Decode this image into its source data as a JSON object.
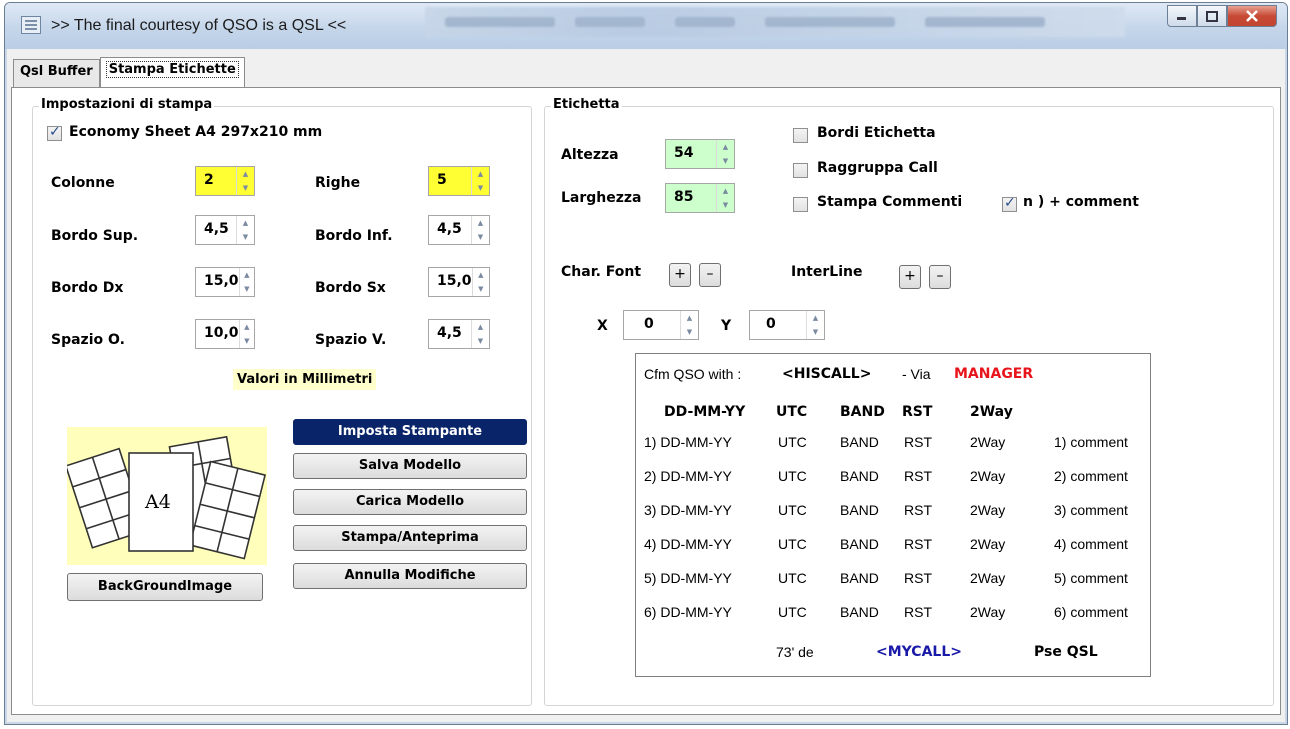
{
  "window": {
    "title": ">> The final courtesy of QSO is a QSL <<",
    "minimize": "minimize",
    "maximize": "maximize",
    "close": "close"
  },
  "tabs": [
    {
      "label": "Qsl Buffer",
      "active": false
    },
    {
      "label": "Stampa Etichette",
      "active": true
    }
  ],
  "print_settings": {
    "title": "Impostazioni di stampa",
    "economy_sheet": {
      "label": "Economy Sheet A4 297x210 mm",
      "checked": true
    },
    "colonne": {
      "label": "Colonne",
      "value": "2"
    },
    "righe": {
      "label": "Righe",
      "value": "5"
    },
    "bordo_sup": {
      "label": "Bordo Sup.",
      "value": "4,5"
    },
    "bordo_inf": {
      "label": "Bordo Inf.",
      "value": "4,5"
    },
    "bordo_dx": {
      "label": "Bordo Dx",
      "value": "15,0"
    },
    "bordo_sx": {
      "label": "Bordo Sx",
      "value": "15,0"
    },
    "spazio_o": {
      "label": "Spazio O.",
      "value": "10,0"
    },
    "spazio_v": {
      "label": "Spazio V.",
      "value": "4,5"
    },
    "units_note": "Valori in Millimetri",
    "a4_text": "A4",
    "buttons": {
      "imposta_stampante": "Imposta Stampante",
      "salva_modello": "Salva Modello",
      "carica_modello": "Carica Modello",
      "stampa_anteprima": "Stampa/Anteprima",
      "annulla_modifiche": "Annulla Modifiche",
      "background_image": "BackGroundImage"
    }
  },
  "label_settings": {
    "title": "Etichetta",
    "altezza": {
      "label": "Altezza",
      "value": "54"
    },
    "larghezza": {
      "label": "Larghezza",
      "value": "85"
    },
    "bordi_etichetta": {
      "label": "Bordi Etichetta",
      "checked": false
    },
    "raggruppa_call": {
      "label": "Raggruppa Call",
      "checked": false
    },
    "stampa_commenti": {
      "label": "Stampa Commenti",
      "checked": false
    },
    "n_comment": {
      "label": "n ) + comment",
      "checked": true
    },
    "char_font": {
      "label": "Char. Font",
      "plus": "+",
      "minus": "–"
    },
    "interline": {
      "label": "InterLine",
      "plus": "+",
      "minus": "–"
    },
    "x": {
      "label": "X",
      "value": "0"
    },
    "y": {
      "label": "Y",
      "value": "0"
    }
  },
  "preview": {
    "cfm": "Cfm QSO with :",
    "hiscall": "<HISCALL>",
    "via": "- Via",
    "manager": "MANAGER",
    "headers": [
      "DD-MM-YY",
      "UTC",
      "BAND",
      "RST",
      "2Way"
    ],
    "rows": [
      [
        "1) DD-MM-YY",
        "UTC",
        "BAND",
        "RST",
        "2Way",
        "1) comment"
      ],
      [
        "2) DD-MM-YY",
        "UTC",
        "BAND",
        "RST",
        "2Way",
        "2) comment"
      ],
      [
        "3) DD-MM-YY",
        "UTC",
        "BAND",
        "RST",
        "2Way",
        "3) comment"
      ],
      [
        "4) DD-MM-YY",
        "UTC",
        "BAND",
        "RST",
        "2Way",
        "4) comment"
      ],
      [
        "5) DD-MM-YY",
        "UTC",
        "BAND",
        "RST",
        "2Way",
        "5) comment"
      ],
      [
        "6) DD-MM-YY",
        "UTC",
        "BAND",
        "RST",
        "2Way",
        "6) comment"
      ]
    ],
    "footer_73": "73' de",
    "mycall": "<MYCALL>",
    "pse_qsl": "Pse QSL"
  },
  "colors": {
    "manager": "#e8141c",
    "mycall": "#1a1aa8",
    "primary_button": "#0a246a",
    "yellow_spin": "#ffff33",
    "green_spin": "#ccffcc"
  }
}
